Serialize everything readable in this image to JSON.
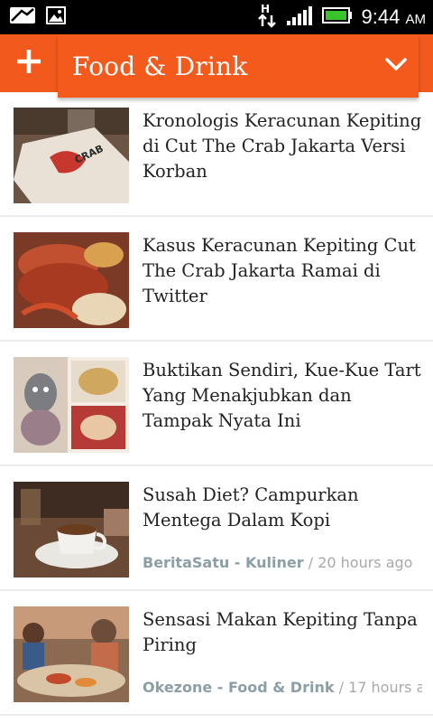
{
  "status_bar": {
    "time": "9:44",
    "ampm": "AM",
    "icons": [
      "mail-icon",
      "image-icon",
      "data-transfer-icon",
      "signal-icon",
      "battery-icon"
    ]
  },
  "app_bar": {
    "add_icon": "plus-icon",
    "title": "Food & Drink",
    "dropdown_icon": "chevron-down-icon",
    "accent_color": "#f2591d"
  },
  "articles": [
    {
      "title": "Kronologis Keracunan Kepiting di Cut The Crab Jakarta Versi Korban",
      "source": "",
      "separator": "",
      "time": ""
    },
    {
      "title": "Kasus Keracunan Kepiting Cut The Crab Jakarta Ramai di Twitter",
      "source": "",
      "separator": "",
      "time": ""
    },
    {
      "title": "Buktikan Sendiri, Kue-Kue Tart Yang Menakjubkan dan Tampak Nyata Ini",
      "source": "",
      "separator": "",
      "time": ""
    },
    {
      "title": "Susah Diet? Campurkan Mentega Dalam Kopi",
      "source": "BeritaSatu - Kuliner",
      "separator": " / ",
      "time": "20 hours ago"
    },
    {
      "title": "Sensasi Makan Kepiting Tanpa Piring",
      "source": "Okezone - Food & Drink",
      "separator": " / ",
      "time": "17 hours a..."
    }
  ]
}
